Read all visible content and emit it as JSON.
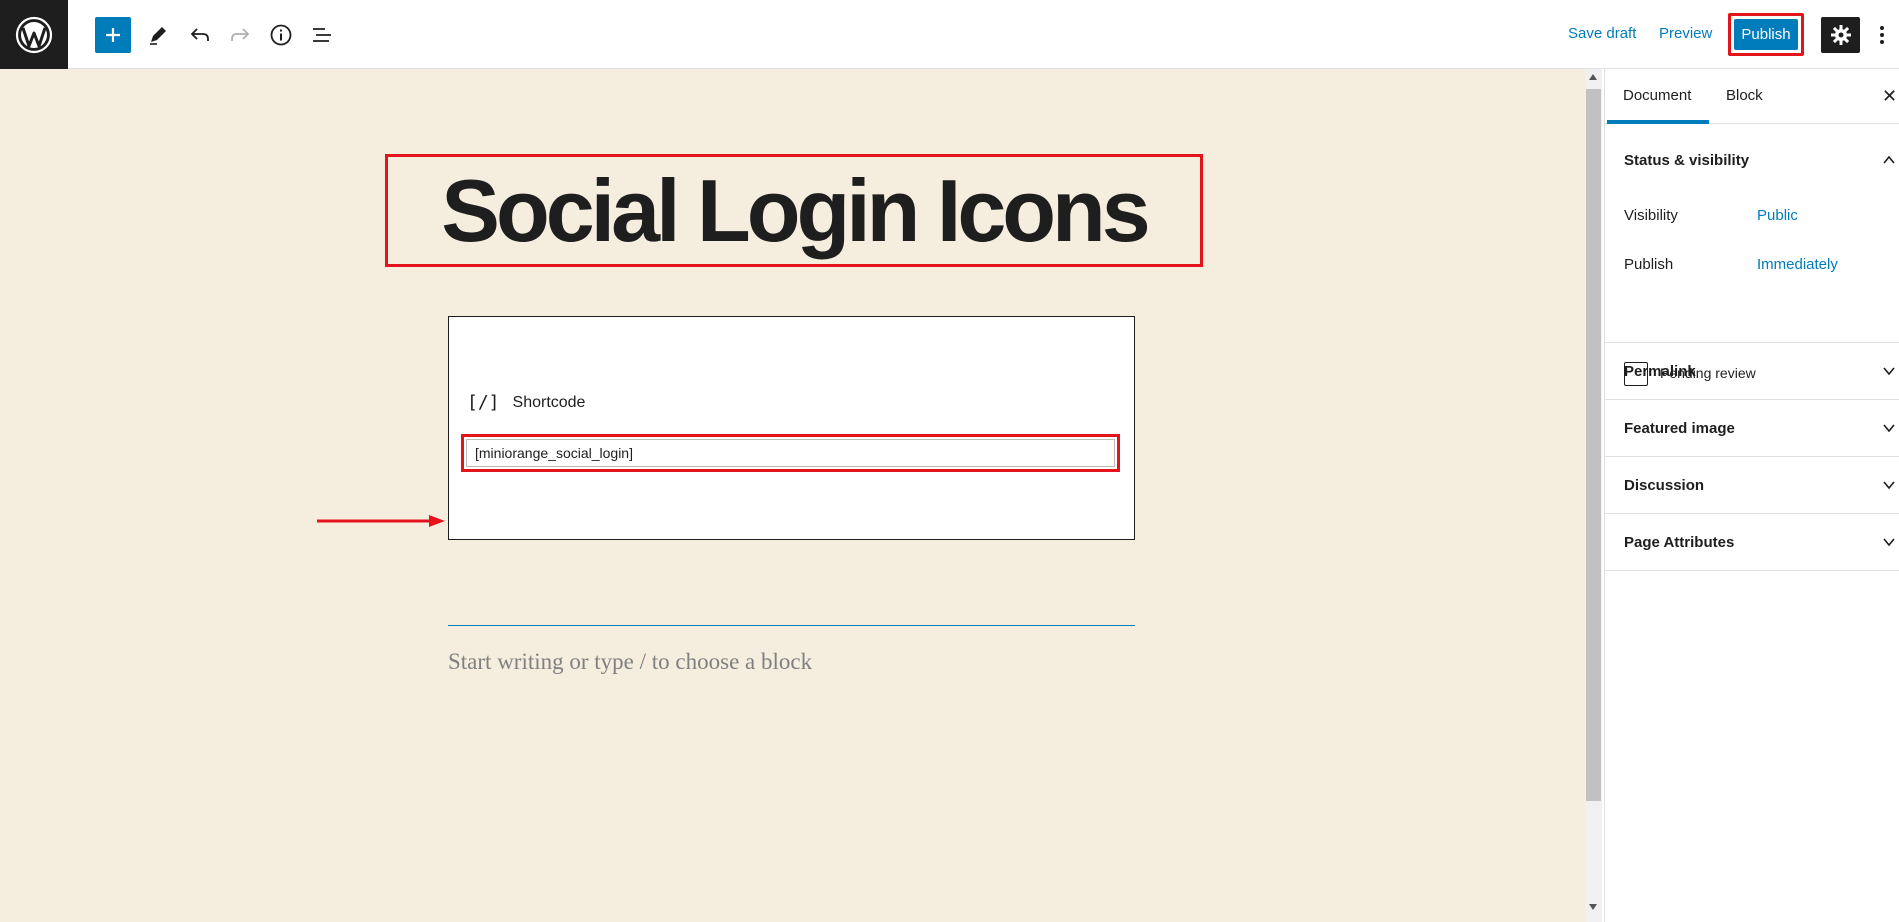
{
  "toolbar": {
    "save_draft_label": "Save draft",
    "preview_label": "Preview",
    "publish_label": "Publish",
    "icons": [
      "wordpress-logo-icon",
      "plus-icon",
      "pencil-icon",
      "undo-icon",
      "redo-icon",
      "info-icon",
      "list-view-icon",
      "gear-icon",
      "more-vertical-icon"
    ]
  },
  "editor": {
    "title": "Social Login Icons",
    "shortcode_block": {
      "icon": "[/]",
      "label": "Shortcode",
      "value": "[miniorange_social_login]"
    },
    "placeholder": "Start writing or type / to choose a block"
  },
  "sidebar": {
    "tabs": [
      {
        "label": "Document",
        "active": true
      },
      {
        "label": "Block",
        "active": false
      }
    ],
    "close_icon": "close-icon",
    "status_visibility": {
      "title": "Status & visibility",
      "expanded": true,
      "visibility_label": "Visibility",
      "visibility_value": "Public",
      "publish_label": "Publish",
      "publish_value": "Immediately",
      "pending_review_label": "Pending review",
      "pending_review_checked": false
    },
    "panels": [
      {
        "title": "Permalink"
      },
      {
        "title": "Featured image"
      },
      {
        "title": "Discussion"
      },
      {
        "title": "Page Attributes"
      }
    ]
  },
  "colors": {
    "accent": "#007cba",
    "highlight_outline": "#e3141c",
    "canvas_bg": "#f5eedf",
    "dark": "#1e1e1e"
  }
}
